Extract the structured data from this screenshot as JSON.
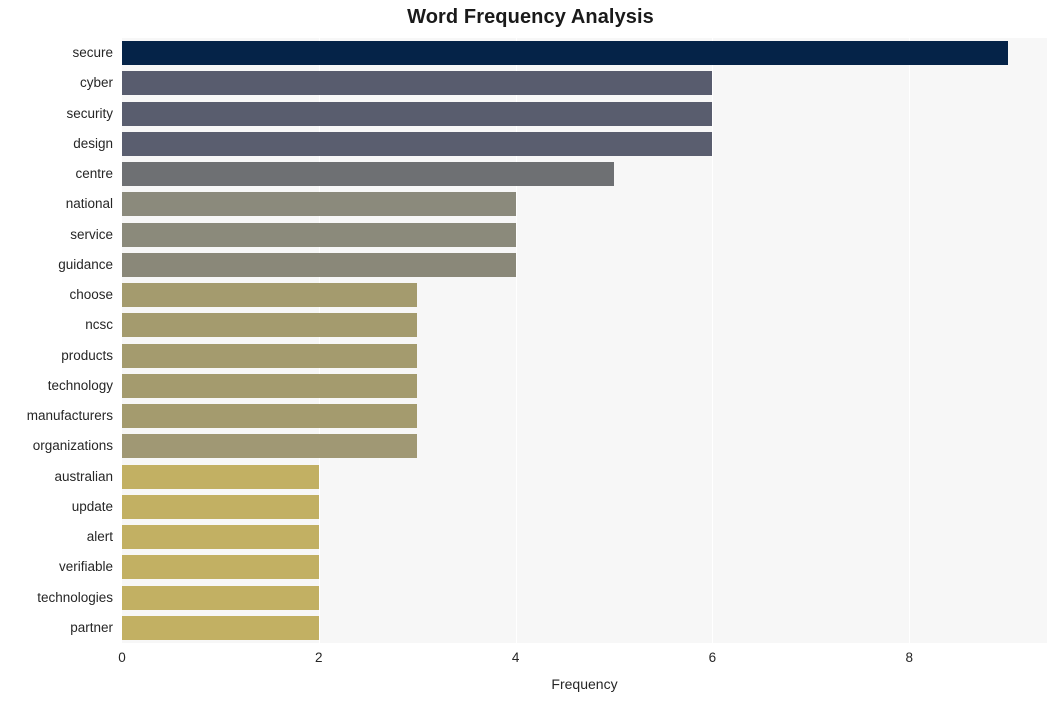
{
  "chart_data": {
    "type": "bar",
    "orientation": "horizontal",
    "title": "Word Frequency Analysis",
    "xlabel": "Frequency",
    "ylabel": "",
    "xlim": [
      0,
      9.4
    ],
    "ylim": [
      0,
      20
    ],
    "grid": true,
    "legend": false,
    "xticks": [
      "0",
      "2",
      "4",
      "6",
      "8"
    ],
    "xtick_values": [
      0,
      2,
      4,
      6,
      8
    ],
    "categories": [
      "secure",
      "cyber",
      "security",
      "design",
      "centre",
      "national",
      "service",
      "guidance",
      "choose",
      "ncsc",
      "products",
      "technology",
      "manufacturers",
      "organizations",
      "australian",
      "update",
      "alert",
      "verifiable",
      "technologies",
      "partner"
    ],
    "values": [
      9,
      6,
      6,
      6,
      5,
      4,
      4,
      4,
      3,
      3,
      3,
      3,
      3,
      3,
      2,
      2,
      2,
      2,
      2,
      2
    ],
    "bar_colors": [
      "#052348",
      "#585c6e",
      "#595d6e",
      "#5a5e6f",
      "#6e7073",
      "#8b8a7c",
      "#8b8a7b",
      "#8a8879",
      "#a49b6e",
      "#a49b6e",
      "#a49b6e",
      "#a49b6e",
      "#a49b6e",
      "#a09874",
      "#c2b063",
      "#c2b063",
      "#c2b063",
      "#c2b063",
      "#c2b063",
      "#c2b063"
    ],
    "plot_background": "#f7f7f7",
    "figure_background": "#ffffff",
    "gridline_color": "#ffffff"
  }
}
